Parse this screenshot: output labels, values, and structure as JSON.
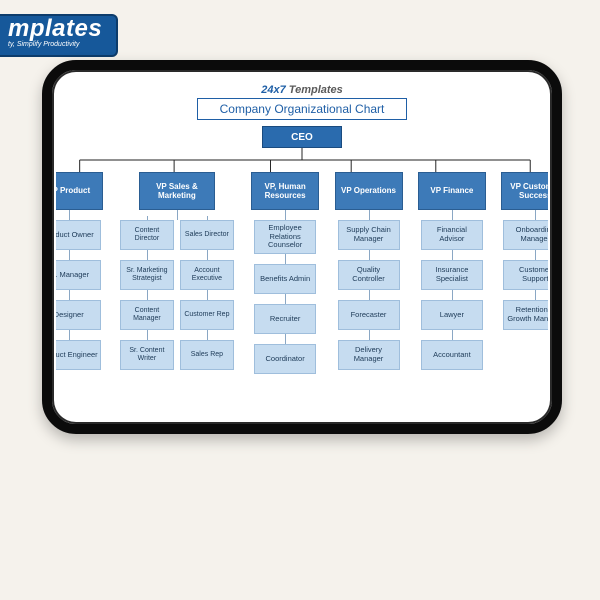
{
  "badge": {
    "brand": "mplates",
    "tag": "ty, Simplify Productivity"
  },
  "header": {
    "brand1": "24x7",
    "brand2": " Templates",
    "title": "Company Organizational Chart"
  },
  "ceo": "CEO",
  "tree": [
    {
      "vp": "VP Product",
      "subs": [
        "Product Owner",
        "Sr. Manager",
        "Designer",
        "Product Engineer"
      ]
    },
    {
      "vp": "VP Sales & Marketing",
      "left": [
        "Content Director",
        "Sr. Marketing Strategist",
        "Content Manager",
        "Sr. Content Writer"
      ],
      "right": [
        "Sales Director",
        "Account Executive",
        "Customer Rep",
        "Sales Rep"
      ]
    },
    {
      "vp": "VP, Human Resources",
      "subs": [
        "Employee Relations Counselor",
        "Benefits Admin",
        "Recruiter",
        "Coordinator"
      ]
    },
    {
      "vp": "VP Operations",
      "subs": [
        "Supply Chain Manager",
        "Quality Controller",
        "Forecaster",
        "Delivery Manager"
      ]
    },
    {
      "vp": "VP Finance",
      "subs": [
        "Financial Advisor",
        "Insurance Specialist",
        "Lawyer",
        "Accountant"
      ]
    },
    {
      "vp": "VP Customer Success",
      "subs": [
        "Onboarding Manager",
        "Customer Support",
        "Retention & Growth Manager"
      ]
    }
  ]
}
